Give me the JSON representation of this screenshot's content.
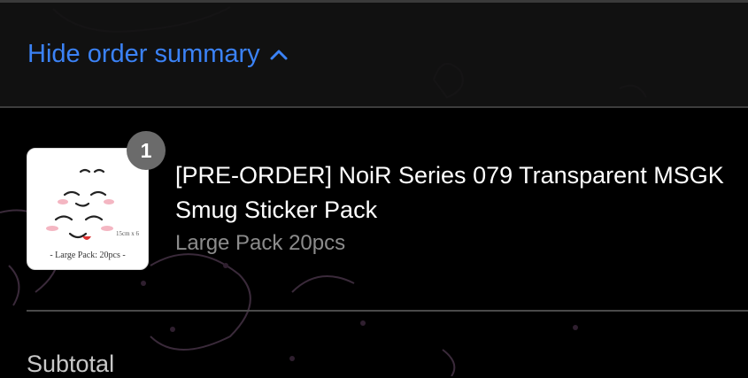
{
  "order_summary": {
    "toggle_label": "Hide order summary",
    "toggle_icon": "chevron-up-icon",
    "accent_color": "#3b82f6"
  },
  "product": {
    "quantity": "1",
    "title": "[PRE-ORDER] NoiR Series 079 Transparent MSGK\nSmug Sticker Pack",
    "variant": "Large Pack 20pcs",
    "thumbnail_caption": "- Large Pack: 20pcs -",
    "thumbnail_size_text": "15cm x 6"
  },
  "totals": {
    "subtotal_label": "Subtotal"
  }
}
